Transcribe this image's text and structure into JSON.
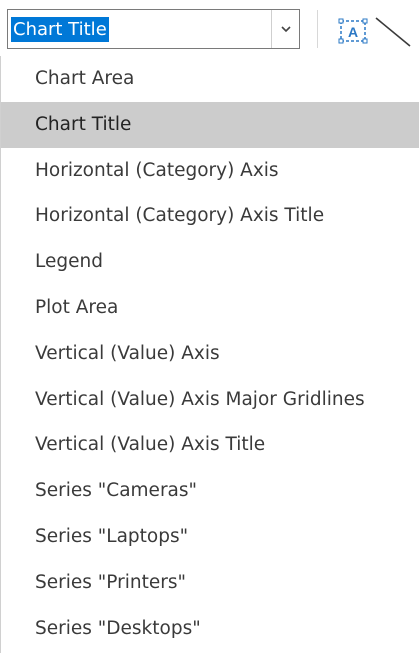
{
  "combo": {
    "value": "Chart Title",
    "dropdown_icon": "chevron-down-icon"
  },
  "toolbar": {
    "format_selection_icon": "text-box-a-icon",
    "line_icon": "diagonal-line-icon"
  },
  "list": {
    "selected_index": 1,
    "items": [
      "Chart Area",
      "Chart Title",
      "Horizontal (Category) Axis",
      "Horizontal (Category) Axis Title",
      "Legend",
      "Plot Area",
      "Vertical (Value) Axis",
      "Vertical (Value) Axis Major Gridlines",
      "Vertical (Value) Axis Title",
      "Series \"Cameras\"",
      "Series \"Laptops\"",
      "Series \"Printers\"",
      "Series \"Desktops\""
    ]
  },
  "colors": {
    "selection_highlight": "#0078d7",
    "hover_row": "#cccccc",
    "icon_blue": "#2b78c5"
  }
}
